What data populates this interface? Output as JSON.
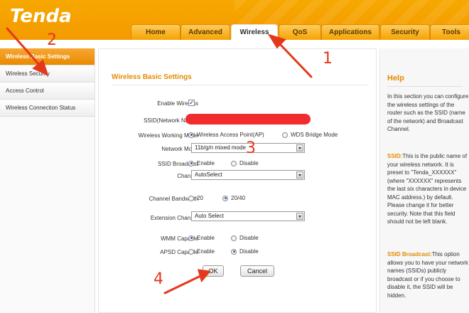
{
  "brand": {
    "logo": "Tenda"
  },
  "tabs": [
    "Home",
    "Advanced",
    "Wireless",
    "QoS",
    "Applications",
    "Security",
    "Tools"
  ],
  "active_tab": "Wireless",
  "sidebar": {
    "items": [
      {
        "label": "Wireless Basic Settings"
      },
      {
        "label": "Wireless Security"
      },
      {
        "label": "Access Control"
      },
      {
        "label": "Wireless Connection Status"
      }
    ]
  },
  "form": {
    "title": "Wireless Basic Settings",
    "enable_wireless_label": "Enable Wireless",
    "enable_wireless_checked": true,
    "ssid_label": "SSID(Network Name)",
    "working_mode_label": "Wireless Working Mode",
    "working_mode_options": [
      "Wireless Access Point(AP)",
      "WDS Bridge Mode"
    ],
    "working_mode_selected": "Wireless Access Point(AP)",
    "network_mode_label": "Network Mode",
    "network_mode_value": "11b/g/n mixed mode",
    "ssid_broadcast_label": "SSID Broadcast",
    "ssid_broadcast_options": [
      "Enable",
      "Disable"
    ],
    "ssid_broadcast_selected": "Enable",
    "channel_label": "Channel",
    "channel_value": "AutoSelect",
    "channel_bandwidth_label": "Channel Bandwidth",
    "channel_bandwidth_options": [
      "20",
      "20/40"
    ],
    "channel_bandwidth_selected": "20/40",
    "extension_channel_label": "Extension Channel",
    "extension_channel_value": "Auto Select",
    "wmm_label": "WMM Capable",
    "wmm_options": [
      "Enable",
      "Disable"
    ],
    "wmm_selected": "Enable",
    "apsd_label": "APSD Capable",
    "apsd_options": [
      "Enable",
      "Disable"
    ],
    "apsd_selected": "Disable",
    "ok_label": "OK",
    "cancel_label": "Cancel"
  },
  "help": {
    "title": "Help",
    "intro": "In this section you can configure the wireless settings of the router such as the SSID (name of the network) and Broadcast Channel.",
    "ssid_key": "SSID:",
    "ssid_text": "This is the public name of your wireless network. It is preset to \"Tenda_XXXXXX\" (where \"XXXXXX\" represents the last six characters in device MAC address.) by default. Please change it for better security. Note that this field should not be left blank.",
    "broadcast_key": "SSID Broadcast:",
    "broadcast_text": "This option allows you to have your network names (SSIDs) publicly broadcast or if you choose to disable it, the SSID will be hidden."
  },
  "annotations": [
    "1",
    "2",
    "3",
    "4"
  ],
  "colors": {
    "accent": "#f39a00",
    "annotation": "#e4381c",
    "redaction": "#f22c2c"
  }
}
